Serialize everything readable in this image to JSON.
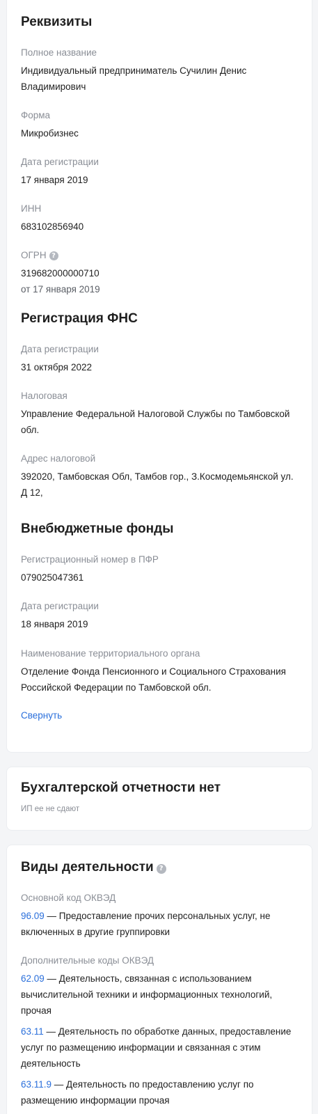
{
  "requisites": {
    "title": "Реквизиты",
    "full_name_label": "Полное название",
    "full_name_value": "Индивидуальный предприниматель Сучилин Денис Владимирович",
    "form_label": "Форма",
    "form_value": "Микробизнес",
    "reg_date_label": "Дата регистрации",
    "reg_date_value": "17 января 2019",
    "inn_label": "ИНН",
    "inn_value": "683102856940",
    "ogrn_label": "ОГРН",
    "ogrn_help_icon": "question-circle-icon",
    "ogrn_value": "319682000000710",
    "ogrn_date": "от 17 января 2019"
  },
  "fns": {
    "title": "Регистрация ФНС",
    "reg_date_label": "Дата регистрации",
    "reg_date_value": "31 октября 2022",
    "tax_label": "Налоговая",
    "tax_value": "Управление Федеральной Налоговой Службы по Тамбовской обл.",
    "tax_address_label": "Адрес налоговой",
    "tax_address_value": "392020, Тамбовская Обл, Тамбов гор., З.Космодемьянской ул. Д 12,"
  },
  "funds": {
    "title": "Внебюджетные фонды",
    "pfr_label": "Регистрационный номер в ПФР",
    "pfr_value": "079025047361",
    "reg_date_label": "Дата регистрации",
    "reg_date_value": "18 января 2019",
    "org_label": "Наименование территориального органа",
    "org_value": "Отделение Фонда Пенсионного и Социального Страхования Российской Федерации по Тамбовской обл."
  },
  "collapse_link": "Свернуть",
  "accounting": {
    "title": "Бухгалтерской отчетности нет",
    "note": "ИП ее не сдают"
  },
  "activities": {
    "title": "Виды деятельности",
    "help_icon": "question-circle-icon",
    "main_label": "Основной код ОКВЭД",
    "main": {
      "code": "96.09",
      "text": " — Предоставление прочих персональных услуг, не включенных в другие группировки"
    },
    "extra_label": "Дополнительные коды ОКВЭД",
    "extra": [
      {
        "code": "62.09",
        "text": " — Деятельность, связанная с использованием вычислительной техники и информационных технологий, прочая"
      },
      {
        "code": "63.11",
        "text": " — Деятельность по обработке данных, предоставление услуг по размещению информации и связанная с этим деятельность"
      },
      {
        "code": "63.11.9",
        "text": " — Деятельность по предоставлению услуг по размещению информации прочая"
      }
    ]
  },
  "colors": {
    "link": "#2a6fdb",
    "label": "#8a8e96",
    "text": "#1f1f1f",
    "background": "#f4f5f7"
  }
}
